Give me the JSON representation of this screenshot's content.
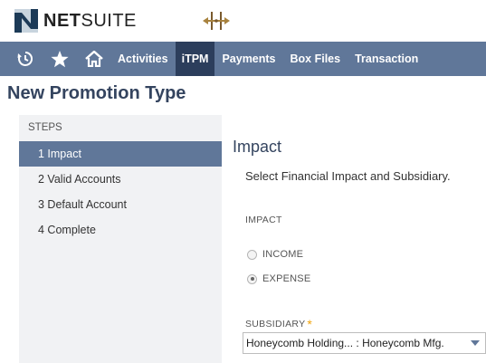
{
  "header": {
    "brand_bold": "NET",
    "brand_light": "SUITE"
  },
  "nav": {
    "items": [
      {
        "label": "Activities"
      },
      {
        "label": "iTPM"
      },
      {
        "label": "Payments"
      },
      {
        "label": "Box Files"
      },
      {
        "label": "Transaction"
      }
    ],
    "active": "iTPM"
  },
  "page": {
    "title": "New Promotion Type"
  },
  "steps": {
    "header": "STEPS",
    "items": [
      {
        "label": "1 Impact"
      },
      {
        "label": "2 Valid Accounts"
      },
      {
        "label": "3 Default Account"
      },
      {
        "label": "4 Complete"
      }
    ],
    "active_index": 0
  },
  "main": {
    "section_title": "Impact",
    "instructions": "Select Financial Impact and Subsidiary.",
    "impact_label": "IMPACT",
    "impact_options": [
      {
        "label": "INCOME",
        "checked": false
      },
      {
        "label": "EXPENSE",
        "checked": true
      }
    ],
    "subsidiary_label": "SUBSIDIARY",
    "required_mark": "*",
    "subsidiary_value": "Honeycomb Holding... : Honeycomb Mfg."
  },
  "colors": {
    "navbar": "#607799",
    "nav_active": "#2c3e5c",
    "title": "#34445f",
    "required": "#f0a30a"
  }
}
